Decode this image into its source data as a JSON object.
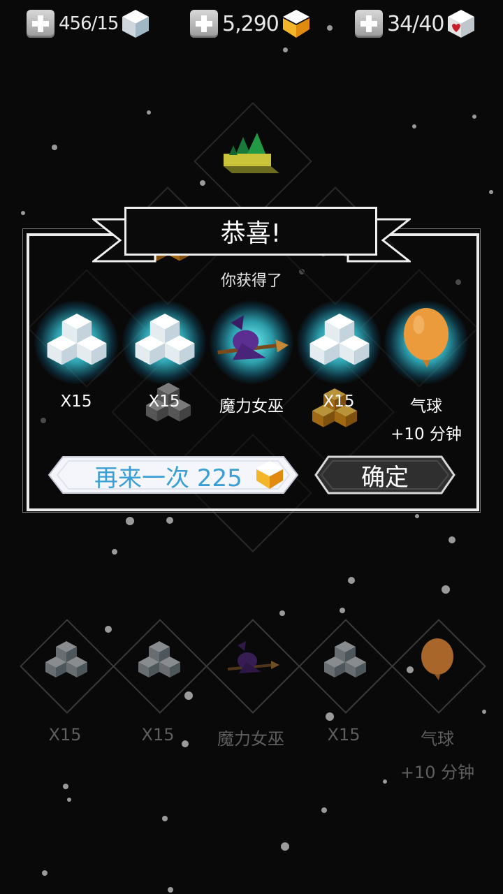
{
  "resources": [
    {
      "value": "456/15",
      "icon": "ice-cube-icon"
    },
    {
      "value": "5,290",
      "icon": "gold-gem-icon"
    },
    {
      "value": "34/40",
      "icon": "heart-cube-icon"
    }
  ],
  "dialog": {
    "title": "恭喜!",
    "subtitle": "你获得了",
    "rewards": [
      {
        "label": "X15",
        "icon": "ice-cubes-icon"
      },
      {
        "label": "X15",
        "icon": "ice-cubes-icon"
      },
      {
        "label": "魔力女巫",
        "icon": "witch-icon"
      },
      {
        "label": "X15",
        "icon": "ice-cubes-icon"
      },
      {
        "label": "气球",
        "sub": "+10 分钟",
        "icon": "balloon-icon"
      }
    ],
    "retry_label": "再来一次",
    "retry_cost": "225",
    "confirm_label": "确定"
  },
  "tray": [
    {
      "label": "X15",
      "icon": "ice-cubes-icon"
    },
    {
      "label": "X15",
      "icon": "ice-cubes-icon"
    },
    {
      "label": "魔力女巫",
      "icon": "witch-icon"
    },
    {
      "label": "X15",
      "icon": "ice-cubes-icon"
    },
    {
      "label": "气球",
      "sub": "+10 分钟",
      "icon": "balloon-icon"
    }
  ],
  "colors": {
    "accent_blue": "#3a9fd4",
    "glow": "#5fe8f5",
    "gold": "#f0b030",
    "balloon": "#e8963a"
  }
}
